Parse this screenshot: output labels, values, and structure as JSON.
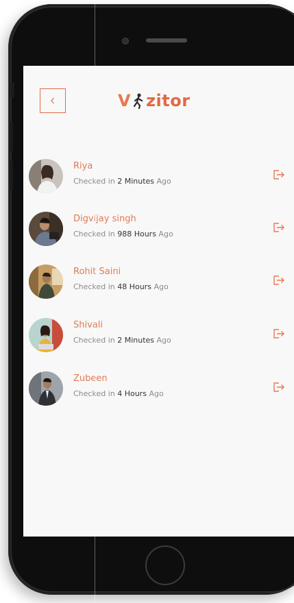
{
  "app": {
    "logo_text_v": "V",
    "logo_text_rest": "zitor",
    "brand_color": "#e06a45"
  },
  "header": {
    "back_icon": "chevron-left-icon"
  },
  "visitors": [
    {
      "name": "Riya",
      "prefix": "Checked in ",
      "duration": "2 Minutes",
      "suffix": " Ago"
    },
    {
      "name": "Digvijay singh",
      "prefix": "Checked in ",
      "duration": "988 Hours",
      "suffix": " Ago"
    },
    {
      "name": "Rohit Saini",
      "prefix": "Checked in ",
      "duration": "48 Hours",
      "suffix": " Ago"
    },
    {
      "name": "Shivali",
      "prefix": "Checked in ",
      "duration": "2 Minutes",
      "suffix": " Ago"
    },
    {
      "name": "Zubeen",
      "prefix": "Checked in ",
      "duration": "4 Hours",
      "suffix": " Ago"
    }
  ],
  "row_icon": "checkout-icon"
}
